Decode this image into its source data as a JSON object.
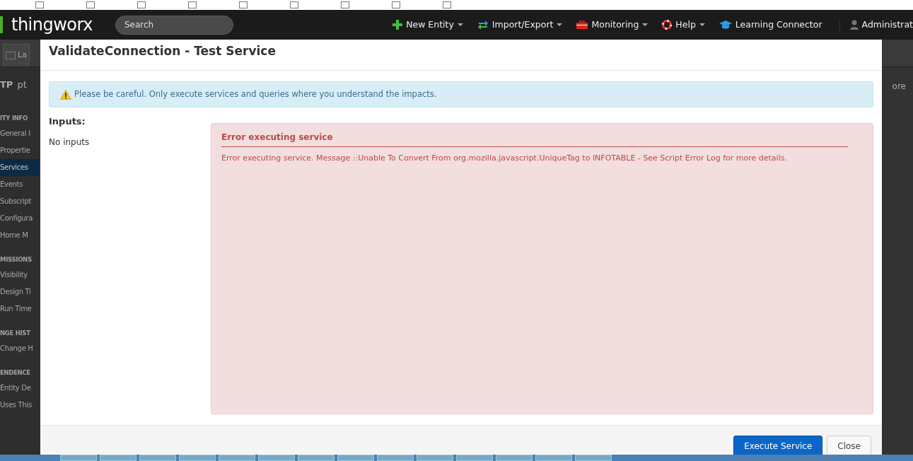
{
  "navbar": {
    "logo": "thingworx",
    "search": {
      "placeholder": "Search"
    },
    "menus": [
      {
        "kind": "plus",
        "label": "New Entity",
        "dropdown": true
      },
      {
        "kind": "arrows",
        "label": "Import/Export",
        "dropdown": true
      },
      {
        "kind": "toolbox",
        "label": "Monitoring",
        "dropdown": true
      },
      {
        "kind": "lifebuoy",
        "label": "Help",
        "dropdown": true
      },
      {
        "kind": "cap",
        "label": "Learning Connector",
        "dropdown": false
      }
    ],
    "user": "Administrat"
  },
  "background": {
    "tab": "La",
    "header": [
      "TP",
      "pt"
    ],
    "more": "ore",
    "sidebar": [
      {
        "kind": "section",
        "label": "ITY INFO"
      },
      {
        "kind": "item",
        "label": "General I",
        "selected": false
      },
      {
        "kind": "item",
        "label": "Propertie",
        "selected": false
      },
      {
        "kind": "item",
        "label": "Services",
        "selected": true
      },
      {
        "kind": "item",
        "label": "Events",
        "selected": false
      },
      {
        "kind": "item",
        "label": "Subscript",
        "selected": false
      },
      {
        "kind": "item",
        "label": "Configura",
        "selected": false
      },
      {
        "kind": "item",
        "label": "Home M",
        "selected": false
      },
      {
        "kind": "section",
        "label": "MISSIONS"
      },
      {
        "kind": "item",
        "label": "Visibility",
        "selected": false
      },
      {
        "kind": "item",
        "label": "Design Ti",
        "selected": false
      },
      {
        "kind": "item",
        "label": "Run Time",
        "selected": false
      },
      {
        "kind": "section",
        "label": "NGE HIST"
      },
      {
        "kind": "item",
        "label": "Change H",
        "selected": false
      },
      {
        "kind": "section",
        "label": "ENDENCE"
      },
      {
        "kind": "item",
        "label": "Entity De",
        "selected": false
      },
      {
        "kind": "item",
        "label": "Uses This",
        "selected": false
      }
    ]
  },
  "modal": {
    "title": "ValidateConnection - Test Service",
    "warning": "Please be careful. Only execute services and queries where you understand the impacts.",
    "inputs_label": "Inputs:",
    "inputs_value": "No inputs",
    "error": {
      "title": "Error executing service",
      "message": "Error executing service. Message ::Unable To Convert From org.mozilla.javascript.UniqueTag to INFOTABLE - See Script Error Log for more details."
    },
    "buttons": [
      {
        "kind": "primary",
        "label": "Execute Service"
      },
      {
        "kind": "secondary",
        "label": "Close"
      }
    ]
  }
}
